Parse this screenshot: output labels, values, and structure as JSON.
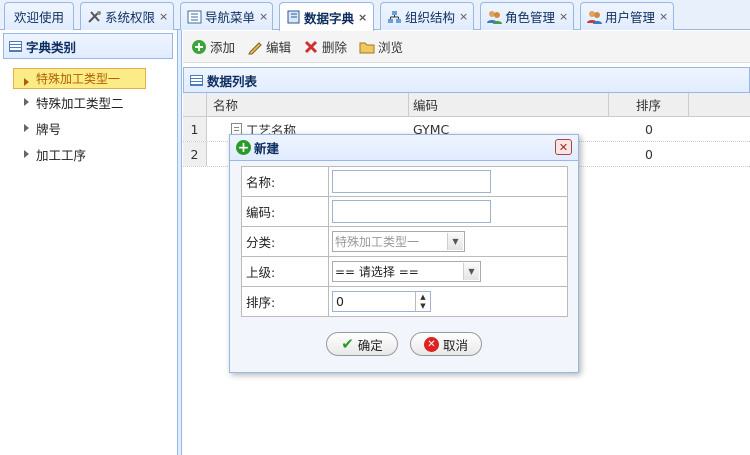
{
  "tabs": [
    {
      "label": "欢迎使用",
      "icon": "none",
      "closable": false
    },
    {
      "label": "系统权限",
      "icon": "tools-icon",
      "closable": true
    },
    {
      "label": "导航菜单",
      "icon": "menu-icon",
      "closable": true
    },
    {
      "label": "数据字典",
      "icon": "book-icon",
      "closable": true,
      "active": true
    },
    {
      "label": "组织结构",
      "icon": "org-chart-icon",
      "closable": true
    },
    {
      "label": "角色管理",
      "icon": "users-icon",
      "closable": true
    },
    {
      "label": "用户管理",
      "icon": "user-group-icon",
      "closable": true
    }
  ],
  "close_glyph": "×",
  "sidebar": {
    "title": "字典类别",
    "items": [
      {
        "label": "特殊加工类型一",
        "selected": true
      },
      {
        "label": "特殊加工类型二"
      },
      {
        "label": "牌号"
      },
      {
        "label": "加工工序"
      }
    ]
  },
  "toolbar": {
    "add": "添加",
    "edit": "编辑",
    "delete": "删除",
    "browse": "浏览"
  },
  "grid": {
    "title": "数据列表",
    "columns": [
      "名称",
      "编码",
      "排序"
    ],
    "rows": [
      {
        "num": "1",
        "name": "工艺名称",
        "code": "GYMC",
        "order": "0"
      },
      {
        "num": "2",
        "name": "",
        "code": "",
        "order": "0"
      }
    ]
  },
  "dialog": {
    "title": "新建",
    "close": "✕",
    "fields": {
      "name_label": "名称:",
      "code_label": "编码:",
      "category_label": "分类:",
      "parent_label": "上级:",
      "order_label": "排序:",
      "category_value": "特殊加工类型一",
      "parent_value": "== 请选择 ==",
      "order_value": "0"
    },
    "ok": "确定",
    "cancel": "取消"
  },
  "colors": {
    "border": "#95b8e7",
    "header_bg": "#e0ecff",
    "selected_bg": "#fbec88",
    "title_text": "#0e2d5f"
  }
}
